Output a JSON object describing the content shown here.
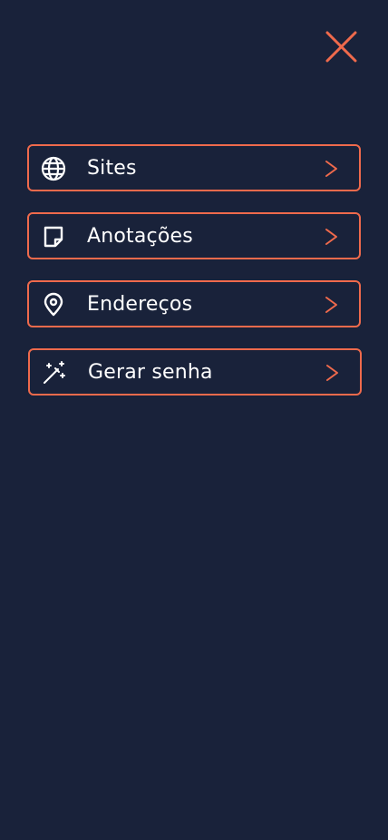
{
  "colors": {
    "background": "#19223a",
    "accent": "#ef6a4c",
    "text": "#ffffff"
  },
  "close_button": {
    "icon": "close-icon"
  },
  "menu": {
    "items": [
      {
        "label": "Sites",
        "icon": "globe-icon",
        "chevron": "chevron-right-icon"
      },
      {
        "label": "Anotações",
        "icon": "sticky-note-icon",
        "chevron": "chevron-right-icon"
      },
      {
        "label": "Endereços",
        "icon": "map-pin-icon",
        "chevron": "chevron-right-icon"
      },
      {
        "label": "Gerar senha",
        "icon": "magic-wand-icon",
        "chevron": "chevron-right-icon"
      }
    ]
  }
}
